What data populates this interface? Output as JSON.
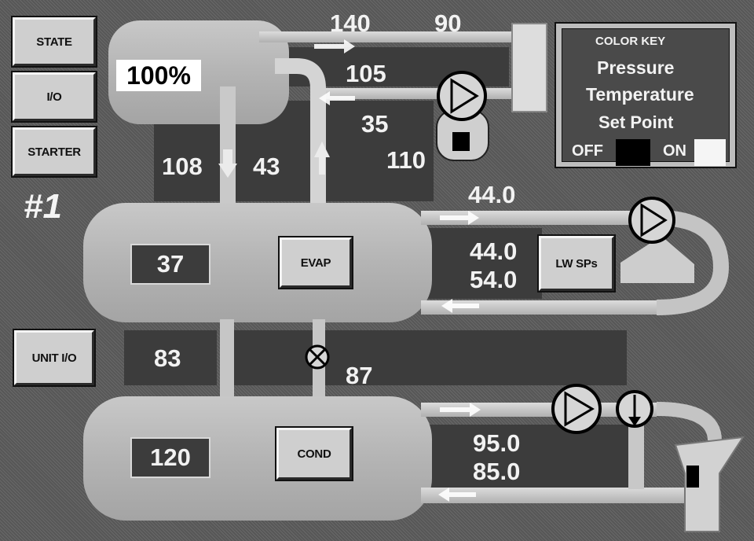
{
  "buttons": {
    "state": "STATE",
    "io": "I/O",
    "starter": "STARTER",
    "unit_io": "UNIT I/O",
    "evap": "EVAP",
    "cond": "COND",
    "lw_sps": "LW SPs"
  },
  "unit_label": "#1",
  "compressor": {
    "load": "100%"
  },
  "readings": {
    "top_140": "140",
    "top_90": "90",
    "v105": "105",
    "v35": "35",
    "v110": "110",
    "v108": "108",
    "v43": "43",
    "evap_out_top": "44.0",
    "evap_sp_leaving": "44.0",
    "evap_sp_entering": "54.0",
    "evap_box": "37",
    "v83": "83",
    "v87": "87",
    "cond_box": "120",
    "cond_top": "95.0",
    "cond_bottom": "85.0"
  },
  "color_key": {
    "title": "COLOR KEY",
    "pressure": "Pressure",
    "temperature": "Temperature",
    "set_point": "Set Point",
    "off": "OFF",
    "on": "ON",
    "off_color": "#000000",
    "on_color": "#f5f5f5"
  },
  "colors": {
    "background": "#575757",
    "vessel": "#b8b8b8",
    "pipe": "#cfcfcf",
    "dark_panel": "#3c3c3c"
  },
  "icons": [
    "pump-icon",
    "valve-icon",
    "flow-arrow-icon",
    "starter-icon"
  ]
}
